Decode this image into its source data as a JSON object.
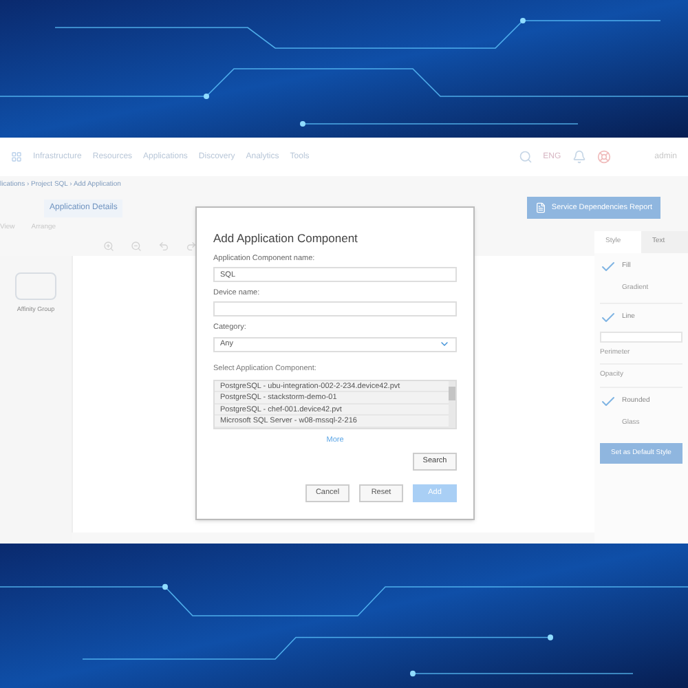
{
  "nav": {
    "items": [
      "Infrastructure",
      "Resources",
      "Applications",
      "Discovery",
      "Analytics",
      "Tools"
    ],
    "language": "ENG",
    "user": "admin"
  },
  "breadcrumb": "lications › Project SQL › Add Application",
  "toolbar": {
    "details_tab": "Application Details",
    "report_button": "Service Dependencies Report",
    "menu": [
      "View",
      "Arrange"
    ]
  },
  "palette": {
    "shape_label": "Affinity Group"
  },
  "format_panel": {
    "tabs": [
      {
        "label": "Style",
        "selected": true
      },
      {
        "label": "Text",
        "selected": false
      }
    ],
    "options": [
      {
        "kind": "check",
        "label": "Fill",
        "checked": true
      },
      {
        "kind": "check",
        "label": "Gradient",
        "checked": false
      },
      {
        "kind": "divider"
      },
      {
        "kind": "check",
        "label": "Line",
        "checked": true
      },
      {
        "kind": "select"
      },
      {
        "kind": "plain",
        "label": "Perimeter"
      },
      {
        "kind": "divider"
      },
      {
        "kind": "plain",
        "label": "Opacity"
      },
      {
        "kind": "divider"
      },
      {
        "kind": "check",
        "label": "Rounded",
        "checked": true
      },
      {
        "kind": "check",
        "label": "Glass",
        "checked": false
      }
    ],
    "default_button": "Set as Default Style"
  },
  "dialog": {
    "title": "Add Application Component",
    "fields": [
      {
        "kind": "text",
        "label": "Application Component name:",
        "value": "SQL"
      },
      {
        "kind": "text",
        "label": "Device name:"
      },
      {
        "kind": "select",
        "label": "Category:",
        "value": "Any"
      }
    ],
    "list_label": "Select Application Component:",
    "list_items": [
      {
        "label": "PostgreSQL - ubu-integration-002-2-234.device42.pvt",
        "selected": false
      },
      {
        "label": "PostgreSQL - stackstorm-demo-01",
        "selected": false
      },
      {
        "label": "PostgreSQL - chef-001.device42.pvt",
        "selected": false
      },
      {
        "label": "Microsoft SQL Server - w08-mssql-2-216",
        "selected": false
      }
    ],
    "more_link": "More",
    "search_button": "Search",
    "buttons": [
      {
        "label": "Cancel",
        "disabled": false
      },
      {
        "label": "Reset",
        "disabled": false
      },
      {
        "label": "Add",
        "disabled": true
      }
    ]
  }
}
